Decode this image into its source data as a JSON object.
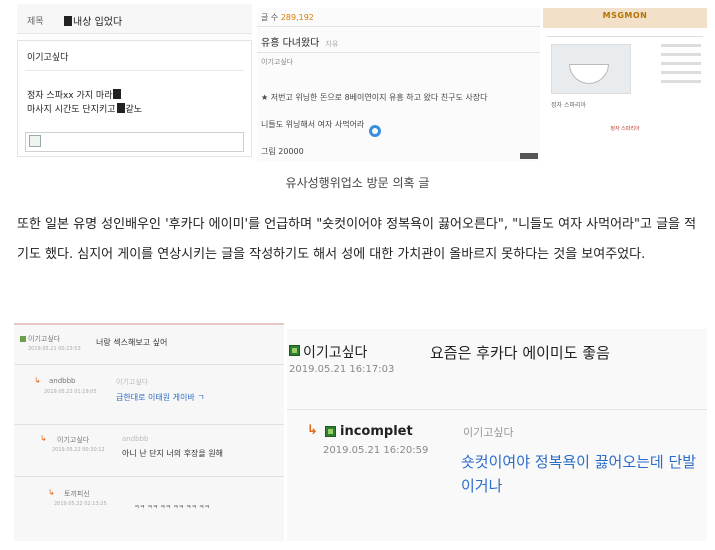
{
  "top_left": {
    "field_label": "제목",
    "subject": "내상 입었다",
    "author": "이기고싶다",
    "line1": "정자 스파xx 가지 마라",
    "line2": "마사지 시간도 단지키고",
    "line2_tail": "같노"
  },
  "top_middle": {
    "count_label": "글 수",
    "count_value": "289,192",
    "title": "유흥 다녀왔다",
    "title_tag": "자유",
    "author": "이기고싶다",
    "body1": "★ 저번고 위닝한 돈으로 8베이연이지 유흥 하고 왔다 친구도 사장다",
    "body2": "니들도 위닝해서 여자 사먹어라",
    "body3": "그림 20000"
  },
  "top_right": {
    "logo": "MSGMON",
    "caption": "정자 스파리아",
    "notice": "정자 스파리아"
  },
  "caption": "유사성행위업소 방문 의혹 글",
  "paragraph": "또한 일본 유명 성인배우인 '후카다 에이미'를 언급하며 \"숏컷이어야 정복욕이 끓어오른다\", \"니들도 여자 사먹어라\"고 글을 적기도 했다. 심지어 게이를 연상시키는 글을 작성하기도 해서 성에 대한 가치관이 올바르지 못하다는 것을 보여주었다.",
  "bottom_left": {
    "rows": [
      {
        "name": "이기고싶다",
        "date": "2019.05.21 00:23:53",
        "content": "너랑 섹스해보고 싶어",
        "blue": false,
        "reply": false
      },
      {
        "name": "andbbb",
        "date": "2019.05.22 01:19:05",
        "content": "급한대로 이태원 게이바 ㄱ",
        "blue": true,
        "reply": true,
        "reply_to": "이기고싶다"
      },
      {
        "name": "이기고싶다",
        "date": "2019.05.22 00:30:12",
        "content": "아니 난 단지 너의 후장을 원해",
        "blue": false,
        "reply": true,
        "reply_to": "andbbb"
      },
      {
        "name": "토끼피신",
        "date": "2019.05.22 02:13:25",
        "content": "ㅋㅋ ㅋㅋ ㅋㅋ ㅋㅋ ㅋㅋ ㅋㅋ",
        "blue": false,
        "reply": true,
        "reply_to": ""
      }
    ]
  },
  "bottom_right": {
    "comment1": {
      "user": "이기고싶다",
      "date": "2019.05.21 16:17:03",
      "content": "요즘은 후카다 에이미도 좋음"
    },
    "comment2": {
      "user": "incomplet",
      "reply_to": "이기고싶다",
      "date": "2019.05.21 16:20:59",
      "content": "숏컷이여야 정복욕이 끓어오는데 단발이거나"
    }
  }
}
